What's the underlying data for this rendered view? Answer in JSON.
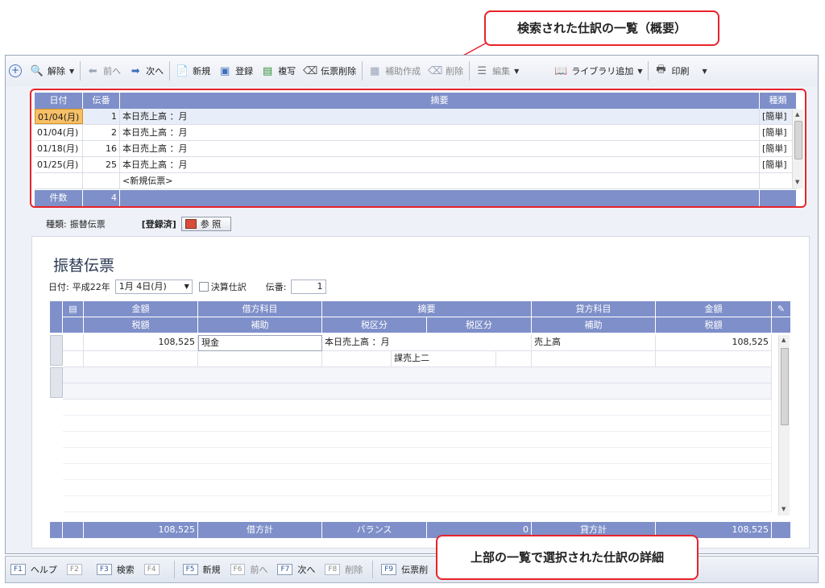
{
  "callouts": {
    "top": "検索された仕訳の一覧（概要）",
    "bottom": "上部の一覧で選択された仕訳の詳細"
  },
  "toolbar": {
    "clear": "解除",
    "prev": "前へ",
    "next": "次へ",
    "new": "新規",
    "register": "登録",
    "copy": "複写",
    "delete_slip": "伝票削除",
    "aux_create": "補助作成",
    "delete": "削除",
    "edit": "編集",
    "library_add": "ライブラリ追加",
    "print": "印刷"
  },
  "list": {
    "headers": [
      "日付",
      "伝番",
      "摘要",
      "種類"
    ],
    "rows": [
      {
        "date": "01/04(月)",
        "no": "1",
        "memo": "本日売上高 ：月",
        "kind": "[簡単]"
      },
      {
        "date": "01/04(月)",
        "no": "2",
        "memo": "本日売上高 ：月",
        "kind": "[簡単]"
      },
      {
        "date": "01/18(月)",
        "no": "16",
        "memo": "本日売上高 ：月",
        "kind": "[簡単]"
      },
      {
        "date": "01/25(月)",
        "no": "25",
        "memo": "本日売上高 ：月",
        "kind": "[簡単]"
      }
    ],
    "new_slip": "<新規伝票>",
    "count_label": "件数",
    "count_value": "4"
  },
  "kind_line": {
    "label": "種類:",
    "value": "振替伝票",
    "status": "[登録済]",
    "ref_button": "参 照"
  },
  "detail": {
    "title": "振替伝票",
    "date_label": "日付:",
    "era": "平成22年",
    "date_value": "1月 4日(月)",
    "closing_label": "決算仕訳",
    "slip_no_label": "伝番:",
    "slip_no_value": "1",
    "headers1": [
      "金額",
      "借方科目",
      "摘要",
      "貸方科目",
      "金額"
    ],
    "headers2": [
      "税額",
      "補助",
      "税区分",
      "税区分",
      "補助",
      "税額"
    ],
    "row1": {
      "debit_amount": "108,525",
      "debit_account": "現金",
      "memo": "本日売上高 ：月",
      "credit_account": "売上高",
      "credit_amount": "108,525"
    },
    "row1b": {
      "tax_class": "課売上二"
    },
    "footer": {
      "debit_total_value": "108,525",
      "debit_total_label": "借方計",
      "balance_label": "バランス",
      "balance_value": "0",
      "credit_total_label": "貸方計",
      "credit_total_value": "108,525"
    }
  },
  "fkeys": [
    {
      "key": "F1",
      "label": "ヘルプ",
      "enabled": true
    },
    {
      "key": "F2",
      "label": "",
      "enabled": false
    },
    {
      "key": "F3",
      "label": "検索",
      "enabled": true
    },
    {
      "key": "F4",
      "label": "",
      "enabled": false
    },
    {
      "key": "F5",
      "label": "新規",
      "enabled": true
    },
    {
      "key": "F6",
      "label": "前へ",
      "enabled": false
    },
    {
      "key": "F7",
      "label": "次へ",
      "enabled": true
    },
    {
      "key": "F8",
      "label": "削除",
      "enabled": false
    },
    {
      "key": "F9",
      "label": "伝票削",
      "enabled": true
    }
  ]
}
